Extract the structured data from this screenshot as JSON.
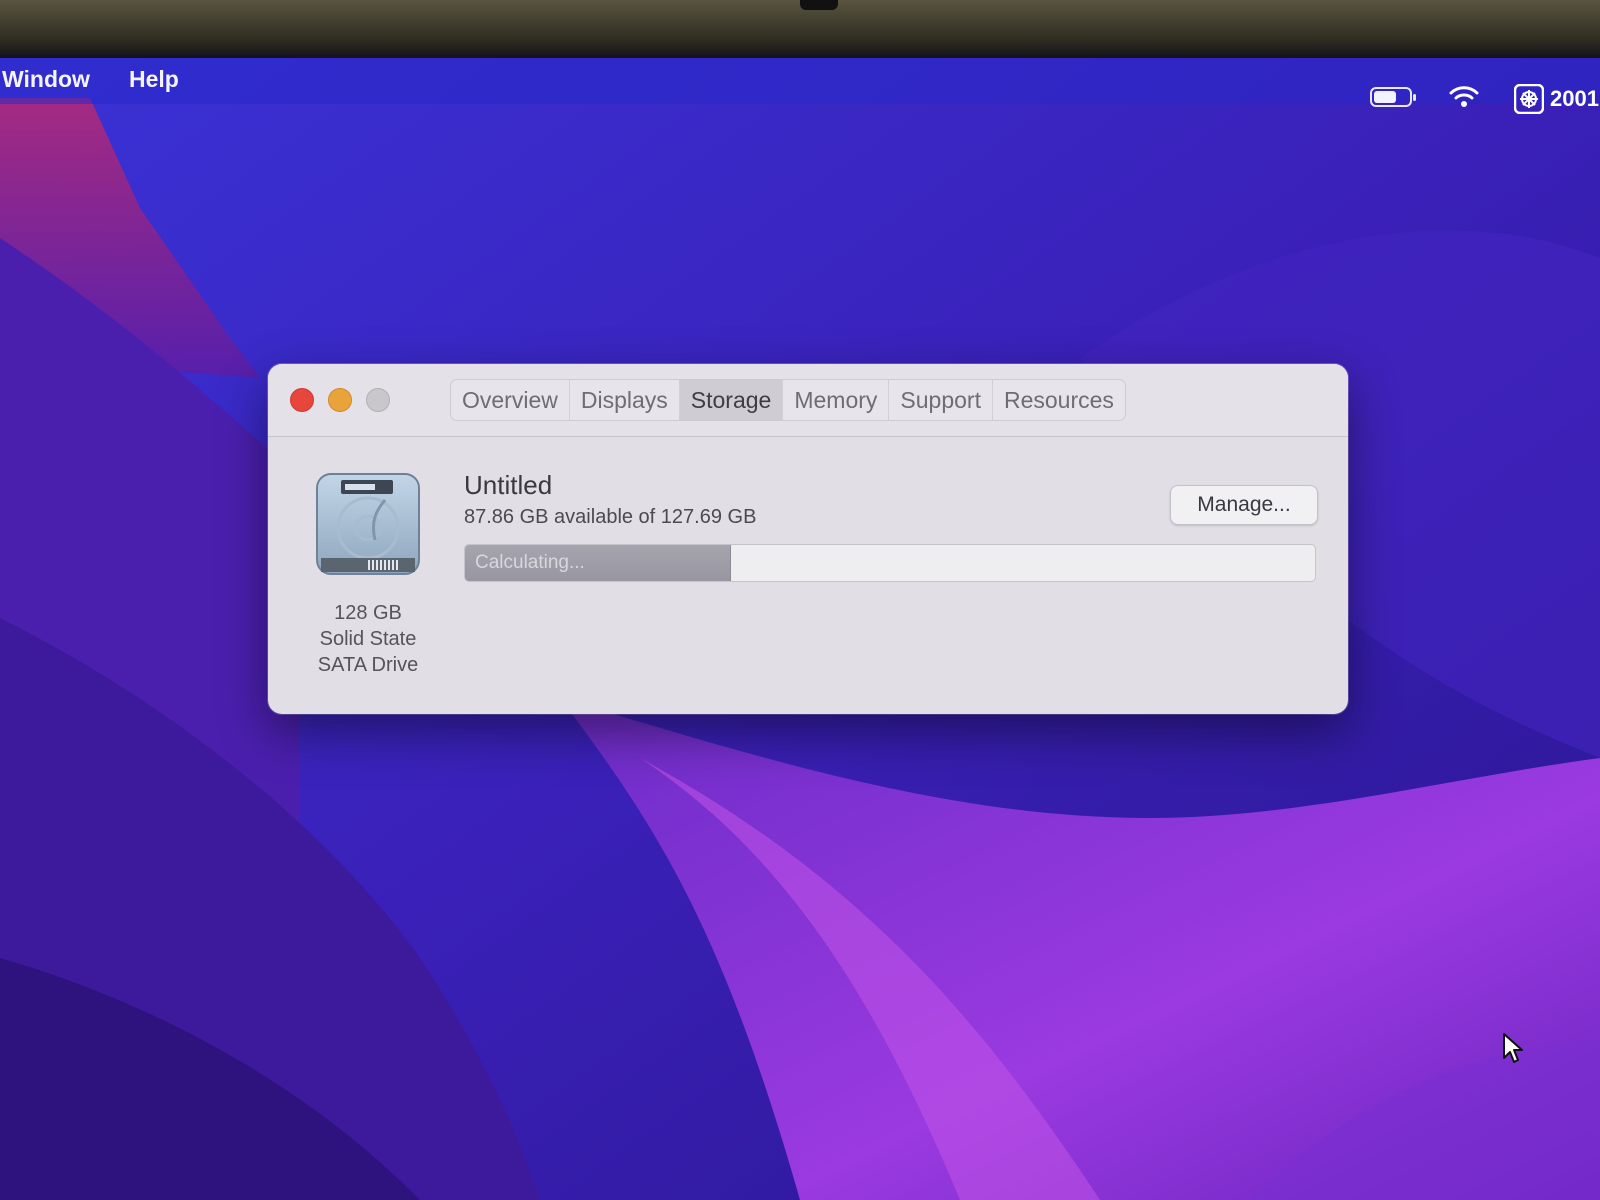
{
  "menubar": {
    "items": [
      "Window",
      "Help"
    ],
    "clock": "2001",
    "icons": [
      "battery-icon",
      "wifi-icon",
      "control-center-icon"
    ]
  },
  "window": {
    "tabs": [
      {
        "label": "Overview",
        "active": false
      },
      {
        "label": "Displays",
        "active": false
      },
      {
        "label": "Storage",
        "active": true
      },
      {
        "label": "Memory",
        "active": false
      },
      {
        "label": "Support",
        "active": false
      },
      {
        "label": "Resources",
        "active": false
      }
    ],
    "disk": {
      "icon": "hard-drive-icon",
      "caption_lines": [
        "128 GB",
        "Solid State",
        "SATA Drive"
      ]
    },
    "volume": {
      "name": "Untitled",
      "available": "87.86 GB available of 127.69 GB",
      "bar_label": "Calculating...",
      "used_fraction": 0.312
    },
    "manage_label": "Manage..."
  },
  "colors": {
    "close": "#e8453c",
    "minimize": "#e9a33a",
    "zoom": "#c9c6cc",
    "menubar": "#2828c8"
  }
}
